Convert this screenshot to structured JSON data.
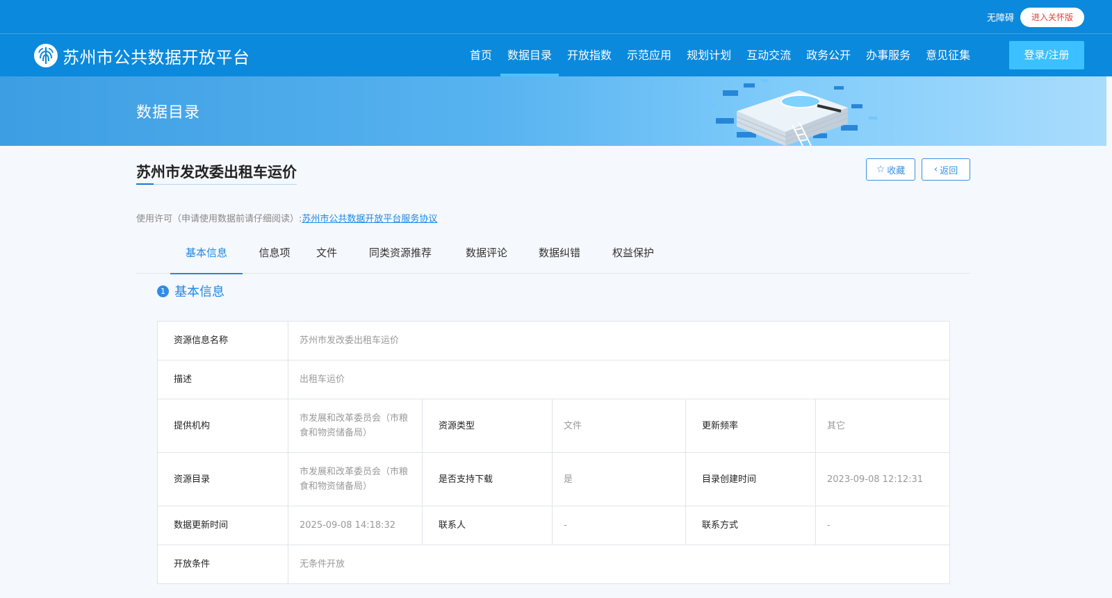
{
  "topbar": {
    "accessibility": "无障碍",
    "care_mode": "进入关怀版"
  },
  "brand": {
    "name": "苏州市公共数据开放平台"
  },
  "nav": {
    "items": [
      "首页",
      "数据目录",
      "开放指数",
      "示范应用",
      "规划计划",
      "互动交流",
      "政务公开",
      "办事服务",
      "意见征集"
    ],
    "active_index": 1,
    "login": "登录/注册"
  },
  "banner": {
    "title": "数据目录"
  },
  "page": {
    "title": "苏州市发改委出租车运价",
    "favorite": "收藏",
    "back": "返回",
    "license_label": "使用许可（申请使用数据前请仔细阅读）:",
    "license_link": "苏州市公共数据开放平台服务协议"
  },
  "tabs": {
    "items": [
      "基本信息",
      "信息项",
      "文件",
      "同类资源推荐",
      "数据评论",
      "数据纠错",
      "权益保护"
    ],
    "active_index": 0
  },
  "section": {
    "number": "1",
    "title": "基本信息"
  },
  "info": {
    "resource_name_label": "资源信息名称",
    "resource_name": "苏州市发改委出租车运价",
    "description_label": "描述",
    "description": "出租车运价",
    "provider_label": "提供机构",
    "provider": "市发展和改革委员会（市粮食和物资储备局）",
    "resource_type_label": "资源类型",
    "resource_type": "文件",
    "update_freq_label": "更新频率",
    "update_freq": "其它",
    "catalog_label": "资源目录",
    "catalog": "市发展和改革委员会（市粮食和物资储备局）",
    "download_label": "是否支持下载",
    "download": "是",
    "created_label": "目录创建时间",
    "created": "2023-09-08 12:12:31",
    "data_updated_label": "数据更新时间",
    "data_updated": "2025-09-08 14:18:32",
    "contact_label": "联系人",
    "contact": "-",
    "contact_method_label": "联系方式",
    "contact_method": "-",
    "open_condition_label": "开放条件",
    "open_condition": "无条件开放"
  },
  "colors": {
    "header": "#0b89dc",
    "accent": "#1e88e5",
    "care_text": "#e0423a",
    "login_bg": "#3cc0ff"
  }
}
